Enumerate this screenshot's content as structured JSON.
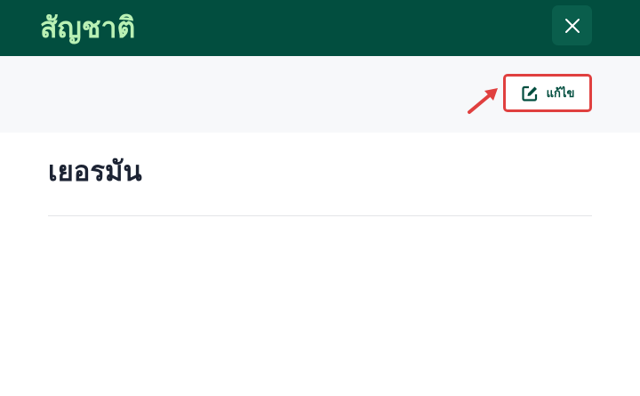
{
  "header": {
    "title": "สัญชาติ",
    "close_icon": "close-icon"
  },
  "toolbar": {
    "edit_label": "แก้ไข",
    "edit_icon": "edit-icon"
  },
  "content": {
    "value": "เยอรมัน"
  },
  "colors": {
    "header_bg": "#024e3f",
    "title_text": "#b9f0b4",
    "highlight_red": "#e0403f",
    "value_text": "#1c2333"
  }
}
